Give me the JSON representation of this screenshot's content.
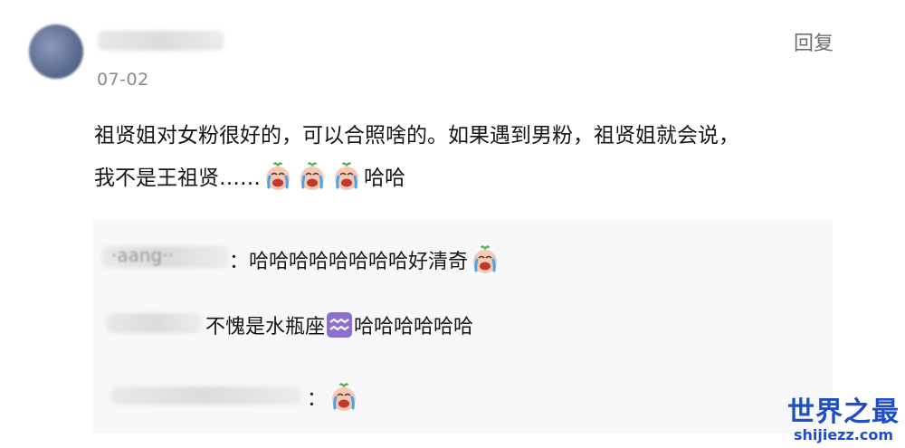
{
  "comment": {
    "date": "07-02",
    "reply_label": "回复",
    "text_part1": "祖贤姐对女粉很好的，可以合照啥的。如果遇到男粉，祖贤姐就会说，",
    "text_part2": "我不是王祖贤……",
    "text_part3": "哈哈",
    "emojis": [
      "cry-laugh-emoji",
      "cry-laugh-emoji",
      "cry-laugh-emoji"
    ]
  },
  "replies": [
    {
      "username_partial": "·aang··",
      "text": "：哈哈哈哈哈哈哈哈好清奇",
      "emoji": "cry-laugh-emoji"
    },
    {
      "text_before": "不愧是水瓶座",
      "symbol": "aquarius-icon",
      "text_after": "哈哈哈哈哈哈"
    },
    {
      "text": "：",
      "emoji": "cry-laugh-emoji"
    }
  ],
  "watermark": {
    "title": "世界之最",
    "url": "shijiezz.com"
  },
  "colors": {
    "watermark_blue": "#1e4fc9",
    "reply_bg": "#f7f8fa",
    "aquarius_purple": "#8a6fd1"
  }
}
